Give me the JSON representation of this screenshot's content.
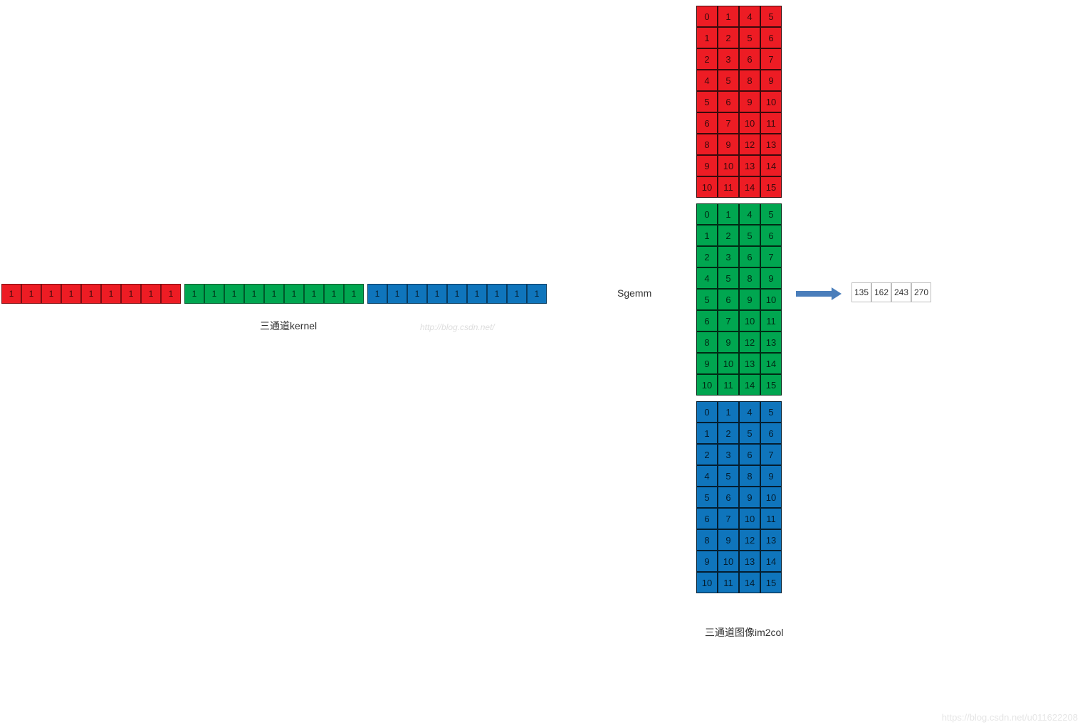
{
  "kernel": {
    "label": "三通道kernel",
    "groups": [
      {
        "color": "red",
        "values": [
          1,
          1,
          1,
          1,
          1,
          1,
          1,
          1,
          1
        ]
      },
      {
        "color": "green",
        "values": [
          1,
          1,
          1,
          1,
          1,
          1,
          1,
          1,
          1
        ]
      },
      {
        "color": "blue",
        "values": [
          1,
          1,
          1,
          1,
          1,
          1,
          1,
          1,
          1
        ]
      }
    ]
  },
  "sgemm_label": "Sgemm",
  "watermark_center": "http://blog.csdn.net/",
  "im2col": {
    "label": "三通道图像im2col",
    "blocks": [
      {
        "color": "red",
        "rows": [
          [
            0,
            1,
            4,
            5
          ],
          [
            1,
            2,
            5,
            6
          ],
          [
            2,
            3,
            6,
            7
          ],
          [
            4,
            5,
            8,
            9
          ],
          [
            5,
            6,
            9,
            10
          ],
          [
            6,
            7,
            10,
            11
          ],
          [
            8,
            9,
            12,
            13
          ],
          [
            9,
            10,
            13,
            14
          ],
          [
            10,
            11,
            14,
            15
          ]
        ]
      },
      {
        "color": "green",
        "rows": [
          [
            0,
            1,
            4,
            5
          ],
          [
            1,
            2,
            5,
            6
          ],
          [
            2,
            3,
            6,
            7
          ],
          [
            4,
            5,
            8,
            9
          ],
          [
            5,
            6,
            9,
            10
          ],
          [
            6,
            7,
            10,
            11
          ],
          [
            8,
            9,
            12,
            13
          ],
          [
            9,
            10,
            13,
            14
          ],
          [
            10,
            11,
            14,
            15
          ]
        ]
      },
      {
        "color": "blue",
        "rows": [
          [
            0,
            1,
            4,
            5
          ],
          [
            1,
            2,
            5,
            6
          ],
          [
            2,
            3,
            6,
            7
          ],
          [
            4,
            5,
            8,
            9
          ],
          [
            5,
            6,
            9,
            10
          ],
          [
            6,
            7,
            10,
            11
          ],
          [
            8,
            9,
            12,
            13
          ],
          [
            9,
            10,
            13,
            14
          ],
          [
            10,
            11,
            14,
            15
          ]
        ]
      }
    ]
  },
  "result": [
    135,
    162,
    243,
    270
  ],
  "watermark_corner": "https://blog.csdn.net/u011622208"
}
